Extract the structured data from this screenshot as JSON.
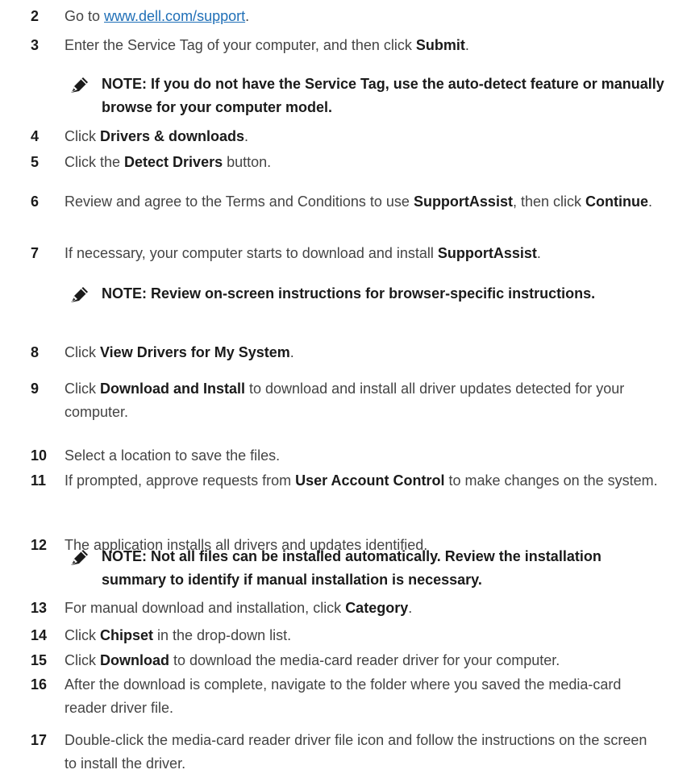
{
  "steps": [
    {
      "num": "2",
      "parts": [
        {
          "t": "Go to "
        },
        {
          "t": "www.dell.com/support",
          "link": true
        },
        {
          "t": "."
        }
      ]
    },
    {
      "num": "3",
      "parts": [
        {
          "t": "Enter the Service Tag of your computer, and then click "
        },
        {
          "t": "Submit",
          "b": true
        },
        {
          "t": "."
        }
      ]
    },
    {
      "num": "4",
      "parts": [
        {
          "t": "Click "
        },
        {
          "t": "Drivers & downloads",
          "b": true
        },
        {
          "t": "."
        }
      ]
    },
    {
      "num": "5",
      "parts": [
        {
          "t": "Click the "
        },
        {
          "t": "Detect Drivers",
          "b": true
        },
        {
          "t": " button."
        }
      ]
    },
    {
      "num": "6",
      "parts": [
        {
          "t": "Review and agree to the Terms and Conditions to use "
        },
        {
          "t": "SupportAssist",
          "b": true
        },
        {
          "t": ", then click "
        },
        {
          "t": "Continue",
          "b": true
        },
        {
          "t": "."
        }
      ]
    },
    {
      "num": "7",
      "parts": [
        {
          "t": "If necessary, your computer starts to download and install "
        },
        {
          "t": "SupportAssist",
          "b": true
        },
        {
          "t": "."
        }
      ]
    },
    {
      "num": "8",
      "parts": [
        {
          "t": "Click "
        },
        {
          "t": "View Drivers for My System",
          "b": true
        },
        {
          "t": "."
        }
      ]
    },
    {
      "num": "9",
      "parts": [
        {
          "t": "Click "
        },
        {
          "t": "Download and Install",
          "b": true
        },
        {
          "t": " to download and install all driver updates detected for your computer."
        }
      ]
    },
    {
      "num": "10",
      "parts": [
        {
          "t": "Select a location to save the files."
        }
      ]
    },
    {
      "num": "11",
      "parts": [
        {
          "t": "If prompted, approve requests from "
        },
        {
          "t": "User Account Control",
          "b": true
        },
        {
          "t": " to make changes on the system."
        }
      ]
    },
    {
      "num": "12",
      "parts": [
        {
          "t": "The application installs all drivers and updates identified."
        }
      ]
    },
    {
      "num": "13",
      "parts": [
        {
          "t": "For manual download and installation, click "
        },
        {
          "t": "Category",
          "b": true
        },
        {
          "t": "."
        }
      ]
    },
    {
      "num": "14",
      "parts": [
        {
          "t": "Click "
        },
        {
          "t": "Chipset",
          "b": true
        },
        {
          "t": " in the drop-down list."
        }
      ]
    },
    {
      "num": "15",
      "parts": [
        {
          "t": "Click "
        },
        {
          "t": "Download",
          "b": true
        },
        {
          "t": " to download the media-card reader driver for your computer."
        }
      ]
    },
    {
      "num": "16",
      "parts": [
        {
          "t": "After the download is complete, navigate to the folder where you saved the media-card reader driver file."
        }
      ]
    },
    {
      "num": "17",
      "parts": [
        {
          "t": "Double-click the media-card reader driver file icon and follow the instructions on the screen to install the driver."
        }
      ]
    }
  ],
  "notes": [
    {
      "text": "NOTE: If you do not have the Service Tag, use the auto-detect feature or manually browse for your computer model.",
      "icon": "note-pencil-icon"
    },
    {
      "text": "NOTE: Review on-screen instructions for browser-specific instructions.",
      "icon": "note-pencil-icon"
    },
    {
      "text": "NOTE: Not all files can be installed automatically. Review the installation summary to identify if manual installation is necessary.",
      "icon": "note-pencil-icon"
    }
  ],
  "colors": {
    "link": "#1f6fb7",
    "text": "#444444",
    "strong": "#1a1a1a"
  }
}
